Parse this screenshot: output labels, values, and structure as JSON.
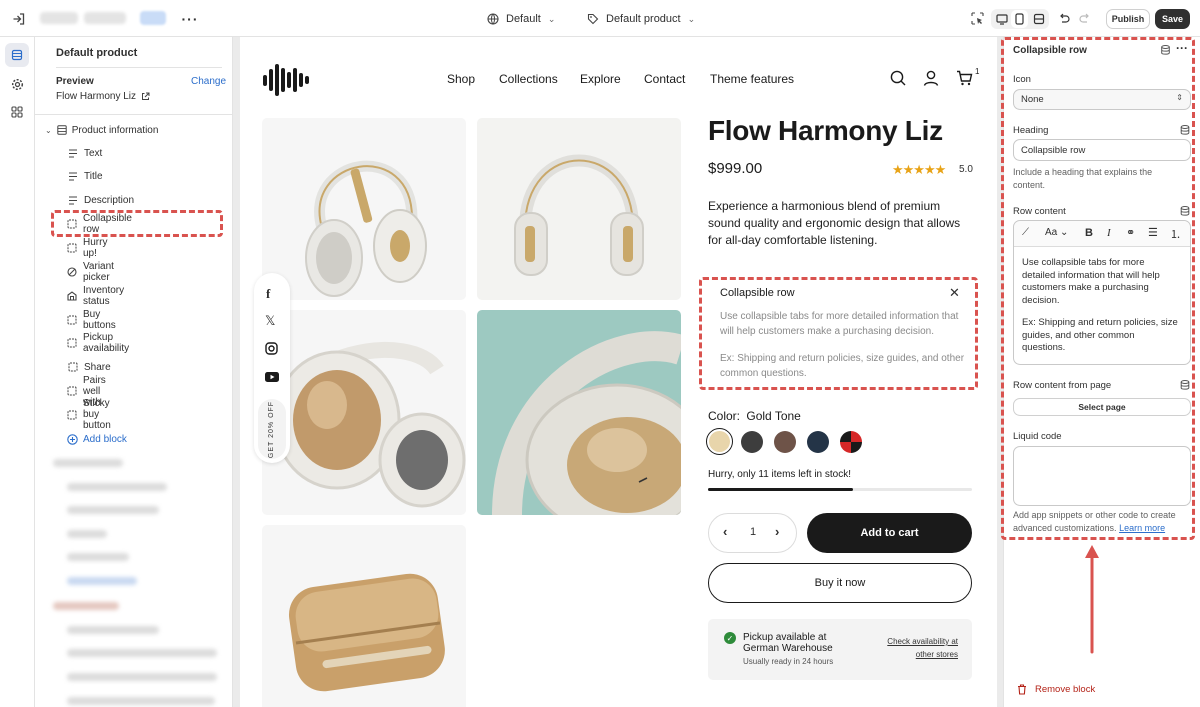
{
  "topbar": {
    "theme_select": "Default",
    "template_select": "Default product",
    "publish_label": "Publish",
    "save_label": "Save"
  },
  "left_panel": {
    "title": "Default product",
    "preview_label": "Preview",
    "change_label": "Change",
    "preview_product": "Flow Harmony Liz",
    "section_label": "Product information",
    "blocks": [
      {
        "label": "Text",
        "icon": "text-icon"
      },
      {
        "label": "Title",
        "icon": "text-icon"
      },
      {
        "label": "Description",
        "icon": "text-icon"
      },
      {
        "label": "Collapsible row",
        "icon": "collapsible-icon"
      },
      {
        "label": "Hurry up!",
        "icon": "collapsible-icon"
      },
      {
        "label": "Variant picker",
        "icon": "variant-icon"
      },
      {
        "label": "Inventory status",
        "icon": "inventory-icon"
      },
      {
        "label": "Buy buttons",
        "icon": "collapsible-icon"
      },
      {
        "label": "Pickup availability",
        "icon": "collapsible-icon"
      },
      {
        "label": "Share",
        "icon": "collapsible-icon"
      },
      {
        "label": "Pairs well with",
        "icon": "collapsible-icon"
      },
      {
        "label": "Sticky buy button",
        "icon": "collapsible-icon"
      }
    ],
    "add_block_label": "Add block"
  },
  "store": {
    "nav": [
      "Shop",
      "Collections",
      "Explore",
      "Contact",
      "Theme features"
    ],
    "cart_count": "1",
    "social_sidebar_text": "GET 20% OFF",
    "product_title": "Flow Harmony Liz",
    "price": "$999.00",
    "rating": "5.0",
    "stars": 5,
    "description": "Experience a harmonious blend of premium sound quality and ergonomic design that allows for all-day comfortable listening.",
    "collapsible": {
      "heading": "Collapsible row",
      "p1": "Use collapsible tabs for more detailed information that will help customers make a purchasing decision.",
      "p2": "Ex: Shipping and return policies, size guides, and other common questions."
    },
    "color_label": "Color:",
    "color_value": "Gold Tone",
    "swatches": [
      "#e8d5ab",
      "#3d3d3d",
      "#6e5348",
      "#243447",
      "split"
    ],
    "stock_text": "Hurry, only 11 items left in stock!",
    "stock_progress": 0.55,
    "quantity": "1",
    "add_to_cart": "Add to cart",
    "buy_now": "Buy it now",
    "pickup_title": "Pickup available at German Warehouse",
    "pickup_sub": "Usually ready in 24 hours",
    "pickup_link": "Check availability at other stores"
  },
  "right_panel": {
    "title": "Collapsible row",
    "icon_label": "Icon",
    "icon_value": "None",
    "heading_label": "Heading",
    "heading_value": "Collapsible row",
    "heading_help": "Include a heading that explains the content.",
    "row_content_label": "Row content",
    "row_content_p1": "Use collapsible tabs for more detailed information that will help customers make a purchasing decision.",
    "row_content_p2": "Ex: Shipping and return policies, size guides, and other common questions.",
    "row_content_page_label": "Row content from page",
    "select_page_label": "Select page",
    "liquid_label": "Liquid code",
    "liquid_help": "Add app snippets or other code to create advanced customizations.",
    "learn_more": "Learn more",
    "remove_block": "Remove block"
  },
  "colors": {
    "accent_blue": "#2c6ecb",
    "highlight_red": "#d9534f",
    "dark_button": "#1a1a1a",
    "star": "#e8a317",
    "teal_bg": "#9dc9c1"
  }
}
